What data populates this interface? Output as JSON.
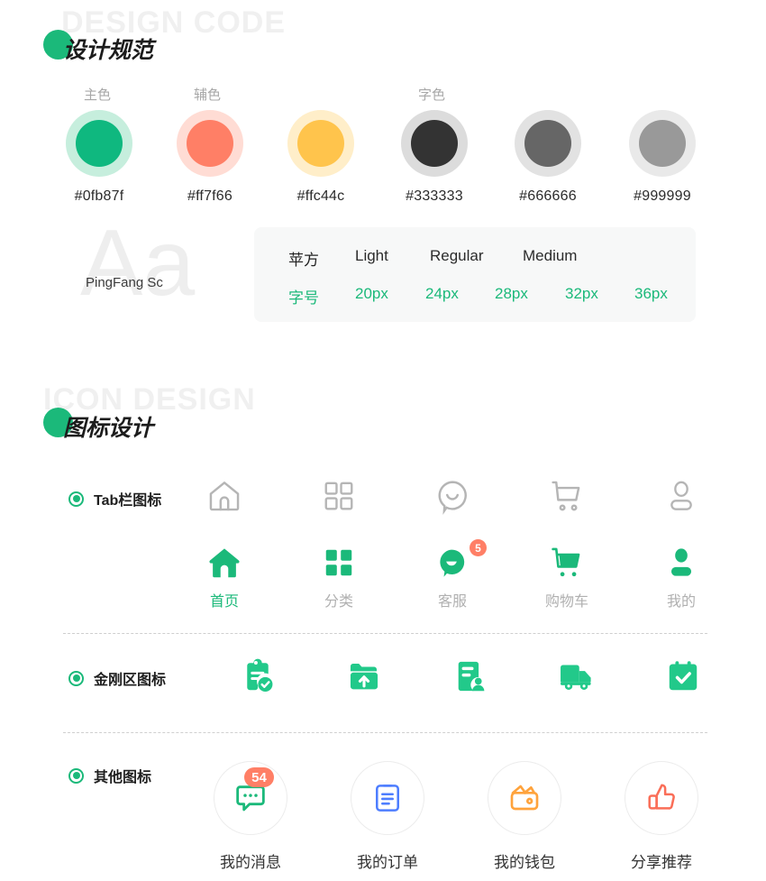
{
  "sections": [
    {
      "watermark": "DESIGN CODE",
      "title": "设计规范"
    },
    {
      "watermark": "ICON DESIGN",
      "title": "图标设计"
    }
  ],
  "colors": {
    "group_labels": [
      {
        "label": "主色"
      },
      {
        "label": "辅色"
      },
      {
        "label": "字色"
      }
    ],
    "swatches": [
      {
        "hex": "#0fb87f",
        "core": "#0fb87f",
        "ring": "#c6eedd"
      },
      {
        "hex": "#ff7f66",
        "core": "#ff7f66",
        "ring": "#ffdcd4"
      },
      {
        "hex": "#ffc44c",
        "core": "#ffc44c",
        "ring": "#ffeec9"
      },
      {
        "hex": "#333333",
        "core": "#333333",
        "ring": "#dcdcdc"
      },
      {
        "hex": "#666666",
        "core": "#666666",
        "ring": "#e2e2e2"
      },
      {
        "hex": "#999999",
        "core": "#999999",
        "ring": "#e9e9e9"
      }
    ]
  },
  "typography": {
    "sample_glyph": "Aa",
    "font_name": "PingFang Sc",
    "family_row_label": "苹方",
    "weights": [
      "Light",
      "Regular",
      "Medium"
    ],
    "size_row_label": "字号",
    "sizes": [
      "20px",
      "24px",
      "28px",
      "32px",
      "36px"
    ]
  },
  "icon_rows": {
    "tabbar": {
      "label": "Tab栏图标",
      "outline_icons": [
        {
          "icon": "home-icon"
        },
        {
          "icon": "grid-icon"
        },
        {
          "icon": "support-chat-icon"
        },
        {
          "icon": "cart-icon"
        },
        {
          "icon": "user-icon"
        }
      ],
      "filled_icons": [
        {
          "icon": "home-filled-icon",
          "caption": "首页",
          "active": true,
          "badge": ""
        },
        {
          "icon": "grid-filled-icon",
          "caption": "分类",
          "active": false,
          "badge": ""
        },
        {
          "icon": "support-chat-filled-icon",
          "caption": "客服",
          "active": false,
          "badge": "5"
        },
        {
          "icon": "cart-filled-icon",
          "caption": "购物车",
          "active": false,
          "badge": ""
        },
        {
          "icon": "user-filled-icon",
          "caption": "我的",
          "active": false,
          "badge": ""
        }
      ]
    },
    "quickentry": {
      "label": "金刚区图标",
      "icons": [
        {
          "icon": "clipboard-check-icon"
        },
        {
          "icon": "folder-upload-icon"
        },
        {
          "icon": "document-user-icon"
        },
        {
          "icon": "delivery-truck-icon"
        },
        {
          "icon": "calendar-check-icon"
        }
      ]
    },
    "other": {
      "label": "其他图标",
      "icons": [
        {
          "icon": "message-bubble-icon",
          "caption": "我的消息",
          "color": "#1bb97a",
          "badge": "54"
        },
        {
          "icon": "order-list-icon",
          "caption": "我的订单",
          "color": "#4d7dff",
          "badge": ""
        },
        {
          "icon": "wallet-icon",
          "caption": "我的钱包",
          "color": "#ffa33c",
          "badge": ""
        },
        {
          "icon": "thumbs-up-icon",
          "caption": "分享推荐",
          "color": "#fa6e58",
          "badge": ""
        }
      ]
    }
  },
  "theme": {
    "brand_green": "#1bb97a",
    "accent_orange": "#ff7f66",
    "watermark_gray": "#f0f0f0"
  }
}
